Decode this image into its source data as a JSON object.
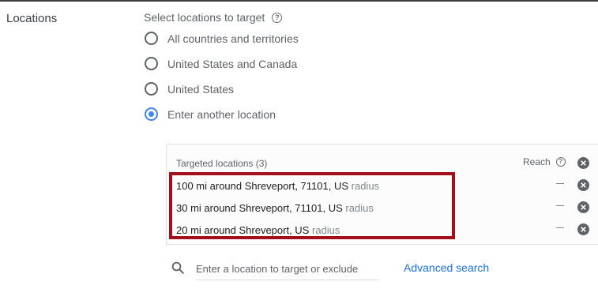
{
  "section": {
    "label": "Locations"
  },
  "select": {
    "heading": "Select locations to target",
    "help_glyph": "?"
  },
  "options": [
    {
      "label": "All countries and territories",
      "checked": false
    },
    {
      "label": "United States and Canada",
      "checked": false
    },
    {
      "label": "United States",
      "checked": false
    },
    {
      "label": "Enter another location",
      "checked": true
    }
  ],
  "targeted": {
    "title": "Targeted locations (3)",
    "reach_label": "Reach",
    "rows": [
      {
        "name": "100 mi around Shreveport, 71101, US",
        "type": "radius",
        "reach": "–"
      },
      {
        "name": "30 mi around Shreveport, 71101, US",
        "type": "radius",
        "reach": "–"
      },
      {
        "name": "20 mi around Shreveport, US",
        "type": "radius",
        "reach": "–"
      }
    ]
  },
  "search": {
    "placeholder": "Enter a location to target or exclude",
    "value": ""
  },
  "advanced_search": {
    "label": "Advanced search"
  },
  "colors": {
    "accent": "#4285f4",
    "link": "#1a73e8",
    "highlight": "#a50e1c"
  }
}
